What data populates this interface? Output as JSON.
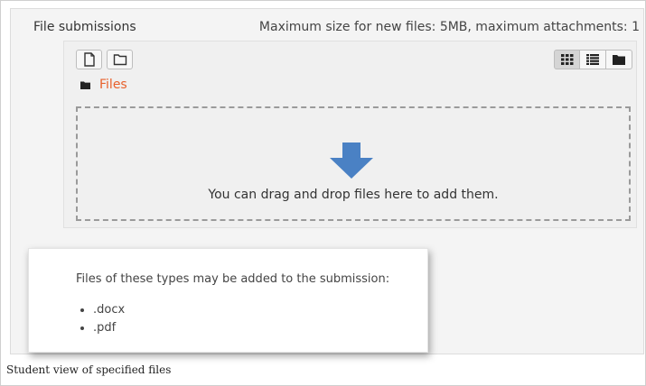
{
  "form": {
    "field_label": "File submissions",
    "max_info": "Maximum size for new files: 5MB, maximum attachments: 1"
  },
  "filepicker": {
    "toolbar": {
      "add_file_icon": "file-icon",
      "create_folder_icon": "folder-outline-icon",
      "views": [
        {
          "icon": "grid-icon",
          "active": true
        },
        {
          "icon": "list-icon",
          "active": false
        },
        {
          "icon": "folder-tree-icon",
          "active": false
        }
      ]
    },
    "path": {
      "folder_icon": "folder-icon",
      "link_text": "Files",
      "link_color": "#e8612c"
    },
    "dropzone": {
      "arrow_icon": "down-arrow-icon",
      "arrow_color": "#4a81c4",
      "text": "You can drag and drop files here to add them."
    }
  },
  "accepted_types": {
    "heading": "Files of these types may be added to the submission:",
    "items": [
      ".docx",
      ".pdf"
    ]
  },
  "caption": "Student view of specified files"
}
